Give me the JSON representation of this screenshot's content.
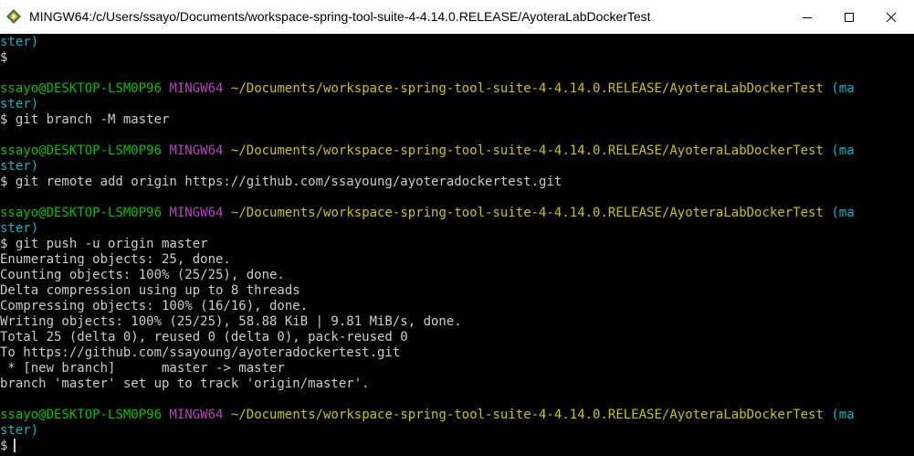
{
  "window": {
    "title": "MINGW64:/c/Users/ssayo/Documents/workspace-spring-tool-suite-4-4.14.0.RELEASE/AyoteraLabDockerTest"
  },
  "colors": {
    "user": "#00c200",
    "system": "#b940bf",
    "path": "#c8c500",
    "branch": "#00b7c3",
    "text": "#cccccc"
  },
  "terminal": {
    "prompt": {
      "user": "ssayo@DESKTOP-LSM0P96",
      "system": "MINGW64",
      "path": "~/Documents/workspace-spring-tool-suite-4-4.14.0.RELEASE/AyoteraLabDockerTest",
      "branch_start": "(ma",
      "branch_end": "ster)",
      "symbol": "$"
    },
    "commands": [
      "$ git branch -M master",
      "$ git remote add origin https://github.com/ssayoung/ayoteradockertest.git",
      "$ git push -u origin master"
    ],
    "output": [
      "Enumerating objects: 25, done.",
      "Counting objects: 100% (25/25), done.",
      "Delta compression using up to 8 threads",
      "Compressing objects: 100% (16/16), done.",
      "Writing objects: 100% (25/25), 58.88 KiB | 9.81 MiB/s, done.",
      "Total 25 (delta 0), reused 0 (delta 0), pack-reused 0",
      "To https://github.com/ssayoung/ayoteradockertest.git",
      " * [new branch]      master -> master",
      "branch 'master' set up to track 'origin/master'."
    ],
    "current_input": "$ "
  }
}
